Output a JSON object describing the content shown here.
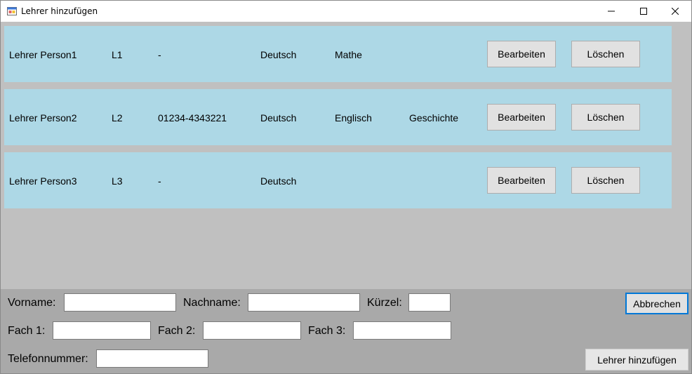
{
  "window": {
    "title": "Lehrer hinzufügen"
  },
  "teachers": [
    {
      "name": "Lehrer Person1",
      "kuerzel": "L1",
      "telefon": "-",
      "fach1": "Deutsch",
      "fach2": "Mathe",
      "fach3": ""
    },
    {
      "name": "Lehrer Person2",
      "kuerzel": "L2",
      "telefon": "01234-4343221",
      "fach1": "Deutsch",
      "fach2": "Englisch",
      "fach3": "Geschichte"
    },
    {
      "name": "Lehrer Person3",
      "kuerzel": "L3",
      "telefon": "-",
      "fach1": "Deutsch",
      "fach2": "",
      "fach3": ""
    }
  ],
  "row_buttons": {
    "edit_label": "Bearbeiten",
    "delete_label": "Löschen"
  },
  "form": {
    "vorname_label": "Vorname:",
    "nachname_label": "Nachname:",
    "kuerzel_label": "Kürzel:",
    "fach1_label": "Fach 1:",
    "fach2_label": "Fach 2:",
    "fach3_label": "Fach 3:",
    "telefon_label": "Telefonnummer:",
    "vorname_value": "",
    "nachname_value": "",
    "kuerzel_value": "",
    "fach1_value": "",
    "fach2_value": "",
    "fach3_value": "",
    "telefon_value": "",
    "cancel_label": "Abbrechen",
    "add_label": "Lehrer hinzufügen"
  },
  "colors": {
    "card_background": "#add8e6",
    "panel_background": "#c0c0c0",
    "form_background": "#a9a9a9",
    "default_button_border": "#0078d7"
  },
  "icons": {
    "app": "window-app-icon",
    "minimize": "minimize-icon",
    "maximize": "maximize-icon",
    "close": "close-icon"
  }
}
